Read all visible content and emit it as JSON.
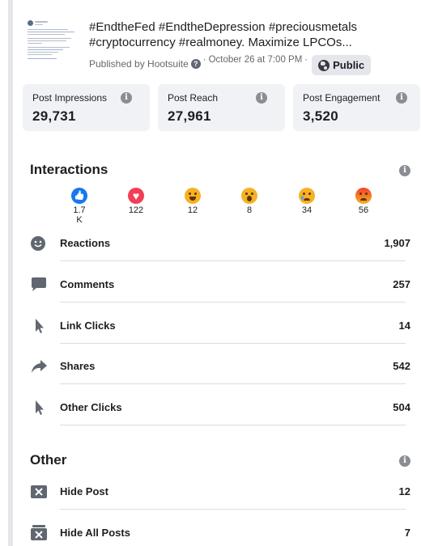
{
  "post": {
    "text": "#EndtheFed #EndtheDepression #preciousmetals #cryptocurrency #realmoney. Maximize LPCOs...",
    "published_by": "Published by Hootsuite",
    "date": "October 26 at 7:00 PM",
    "separator": "·",
    "visibility": "Public"
  },
  "stats": [
    {
      "label": "Post Impressions",
      "value": "29,731"
    },
    {
      "label": "Post Reach",
      "value": "27,961"
    },
    {
      "label": "Post Engagement",
      "value": "3,520"
    }
  ],
  "interactions": {
    "title": "Interactions",
    "reactions": [
      {
        "icon": "like-icon",
        "count": "1.7 K"
      },
      {
        "icon": "love-icon",
        "count": "122"
      },
      {
        "icon": "haha-icon",
        "count": "12"
      },
      {
        "icon": "wow-icon",
        "count": "8"
      },
      {
        "icon": "sad-icon",
        "count": "34"
      },
      {
        "icon": "angry-icon",
        "count": "56"
      }
    ],
    "rows": [
      {
        "icon": "smiley-icon",
        "label": "Reactions",
        "value": "1,907"
      },
      {
        "icon": "comment-icon",
        "label": "Comments",
        "value": "257"
      },
      {
        "icon": "cursor-icon",
        "label": "Link Clicks",
        "value": "14"
      },
      {
        "icon": "share-arrow-icon",
        "label": "Shares",
        "value": "542"
      },
      {
        "icon": "cursor-icon",
        "label": "Other Clicks",
        "value": "504"
      }
    ]
  },
  "other": {
    "title": "Other",
    "rows": [
      {
        "icon": "hide-x-icon",
        "label": "Hide Post",
        "value": "12"
      },
      {
        "icon": "hide-all-icon",
        "label": "Hide All Posts",
        "value": "7"
      }
    ]
  },
  "colors": {
    "card_bg": "#f0f2f5",
    "like": "#1877f2",
    "love": "#f33e58",
    "yellow": "#f7b125",
    "icon_dark": "#606770"
  }
}
